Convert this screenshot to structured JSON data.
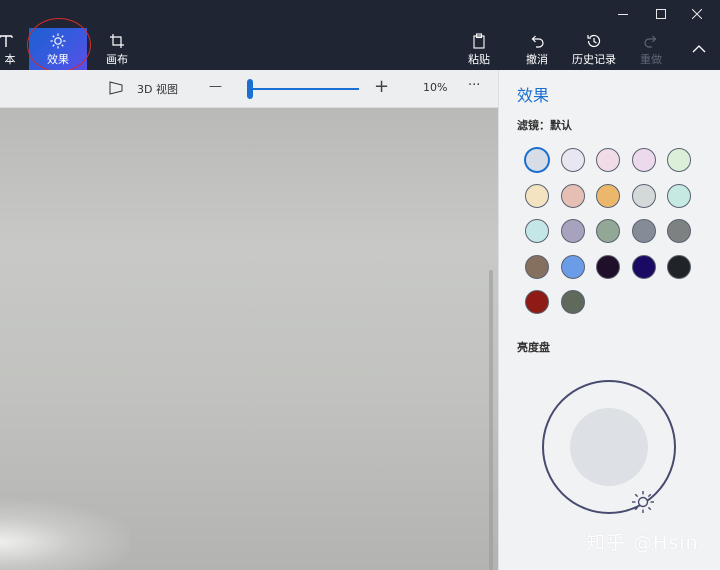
{
  "window": {
    "controls": [
      "minimize",
      "maximize",
      "close"
    ]
  },
  "toolbar": {
    "text_label": "文本",
    "text_visible_label": "本",
    "effects_label": "效果",
    "canvas_label": "画布",
    "paste_label": "粘贴",
    "undo_label": "撤消",
    "history_label": "历史记录",
    "redo_label": "重做",
    "active_tool": "效果"
  },
  "viewbar": {
    "view3d_label": "3D 视图",
    "zoom_minus": "—",
    "zoom_plus": "+",
    "zoom_percent": "10%",
    "zoom_level": 0.05,
    "more": "···"
  },
  "panel": {
    "title": "效果",
    "filter_label": "滤镜：默认",
    "filters": [
      {
        "color": "#d6dde6",
        "selected": true
      },
      {
        "color": "#e8e6f0"
      },
      {
        "color": "#f0dbe6"
      },
      {
        "color": "#ecdaec"
      },
      {
        "color": "#dbefd9"
      },
      {
        "color": "#f3e3c0"
      },
      {
        "color": "#e6bfb4"
      },
      {
        "color": "#ebb86b"
      },
      {
        "color": "#d3d8d8"
      },
      {
        "color": "#c6e9e2"
      },
      {
        "color": "#c4e6e6"
      },
      {
        "color": "#a7a3be"
      },
      {
        "color": "#93a796"
      },
      {
        "color": "#838c97"
      },
      {
        "color": "#7d8181"
      },
      {
        "color": "#857060"
      },
      {
        "color": "#6b9ce7"
      },
      {
        "color": "#200f28"
      },
      {
        "color": "#1a0a63"
      },
      {
        "color": "#202428"
      },
      {
        "color": "#8e1c14"
      },
      {
        "color": "#5f6a5c"
      }
    ],
    "brightness_label": "亮度盘"
  },
  "watermark": "知乎 @Hsin",
  "colors": {
    "accent": "#1b6fd1",
    "toolbar_bg": "#1f2533",
    "panel_bg": "#f1f2f4"
  }
}
